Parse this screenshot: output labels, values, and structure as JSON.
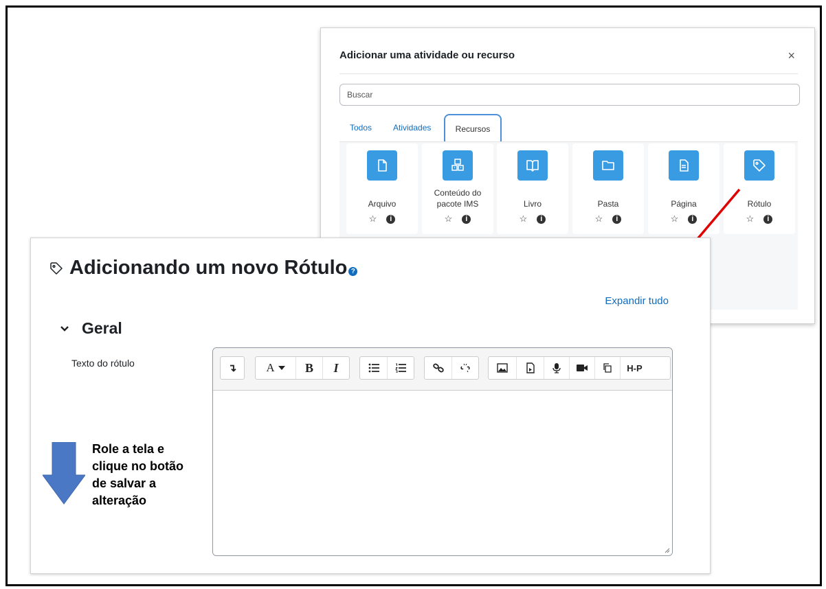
{
  "chooser": {
    "title": "Adicionar uma atividade ou recurso",
    "close_glyph": "×",
    "search_placeholder": "Buscar",
    "tabs": [
      {
        "label": "Todos",
        "active": false
      },
      {
        "label": "Atividades",
        "active": false
      },
      {
        "label": "Recursos",
        "active": true
      }
    ],
    "items": [
      {
        "label": "Arquivo",
        "icon": "file-icon"
      },
      {
        "label": "Conteúdo do pacote IMS",
        "icon": "package-icon"
      },
      {
        "label": "Livro",
        "icon": "book-icon"
      },
      {
        "label": "Pasta",
        "icon": "folder-icon"
      },
      {
        "label": "Página",
        "icon": "page-icon"
      },
      {
        "label": "Rótulo",
        "icon": "tag-icon"
      }
    ],
    "item_star_glyph": "☆",
    "item_info_glyph": "i",
    "accent": "#399be2"
  },
  "form": {
    "title": "Adicionando um novo Rótulo",
    "help_glyph": "?",
    "expand_all": "Expandir tudo",
    "section": "Geral",
    "field_label": "Texto do rótulo",
    "toolbar": {
      "toggle_glyph": "↴",
      "font_glyph": "A",
      "bold_glyph": "B",
      "italic_glyph": "I",
      "h5p_label": "H-P"
    },
    "link_color": "#0f6cbf"
  },
  "annotation": {
    "lines": [
      "Role a tela e",
      "clique no botão",
      "de salvar a",
      "alteração"
    ],
    "arrow_color": "#4a78c4",
    "pointer_color": "#e00000"
  }
}
